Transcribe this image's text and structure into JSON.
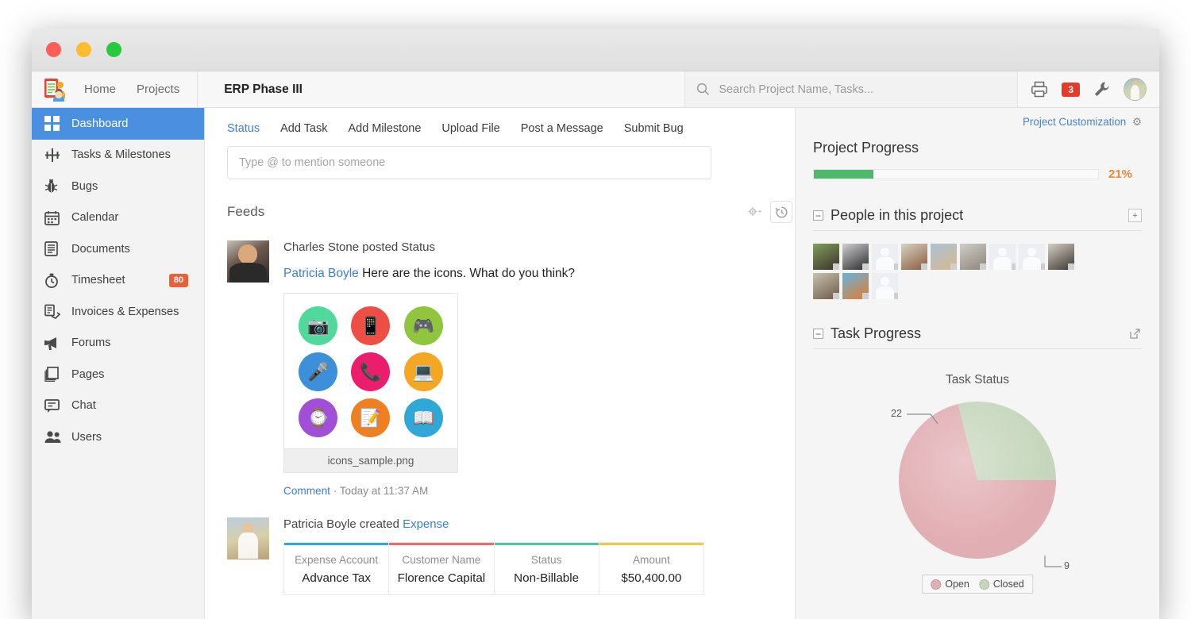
{
  "window": {
    "traffic_lights": [
      "close",
      "minimize",
      "maximize"
    ]
  },
  "topnav": {
    "logo_name": "project-logo",
    "links": [
      {
        "label": "Home",
        "name": "nav-home"
      },
      {
        "label": "Projects",
        "name": "nav-projects"
      }
    ],
    "project_title": "ERP Phase III",
    "search": {
      "placeholder": "Search Project Name, Tasks...",
      "value": ""
    },
    "actions": {
      "print_icon": "printer-icon",
      "notification_count": "3",
      "settings_icon": "wrench-icon",
      "avatar": "user-avatar"
    }
  },
  "sidebar": {
    "items": [
      {
        "label": "Dashboard",
        "icon": "grid-icon",
        "active": true,
        "badge": ""
      },
      {
        "label": "Tasks & Milestones",
        "icon": "milestone-icon",
        "active": false,
        "badge": ""
      },
      {
        "label": "Bugs",
        "icon": "bug-icon",
        "active": false,
        "badge": ""
      },
      {
        "label": "Calendar",
        "icon": "calendar-icon",
        "active": false,
        "badge": ""
      },
      {
        "label": "Documents",
        "icon": "document-icon",
        "active": false,
        "badge": ""
      },
      {
        "label": "Timesheet",
        "icon": "stopwatch-icon",
        "active": false,
        "badge": "80"
      },
      {
        "label": "Invoices & Expenses",
        "icon": "invoice-icon",
        "active": false,
        "badge": ""
      },
      {
        "label": "Forums",
        "icon": "megaphone-icon",
        "active": false,
        "badge": ""
      },
      {
        "label": "Pages",
        "icon": "pages-icon",
        "active": false,
        "badge": ""
      },
      {
        "label": "Chat",
        "icon": "chat-icon",
        "active": false,
        "badge": ""
      },
      {
        "label": "Users",
        "icon": "users-icon",
        "active": false,
        "badge": ""
      }
    ]
  },
  "center": {
    "action_tabs": [
      {
        "label": "Status",
        "active": true
      },
      {
        "label": "Add Task",
        "active": false
      },
      {
        "label": "Add Milestone",
        "active": false
      },
      {
        "label": "Upload File",
        "active": false
      },
      {
        "label": "Post a Message",
        "active": false
      },
      {
        "label": "Submit Bug",
        "active": false
      }
    ],
    "status_box_placeholder": "Type @ to mention someone",
    "feeds_title": "Feeds",
    "feeds_gear_icon": "gear-dropdown-icon",
    "feeds_history_icon": "history-clock-icon",
    "feed_items": [
      {
        "author": "Charles Stone",
        "headline": "Charles Stone posted Status",
        "mention": "Patricia Boyle",
        "message": "Here are the icons. What do you think?",
        "attachment": {
          "filename": "icons_sample.png",
          "icons": [
            {
              "name": "camera-hand-icon",
              "color": "#4fd99a",
              "glyph": "📷"
            },
            {
              "name": "smartphone-hand-icon",
              "color": "#ef4e44",
              "glyph": "📱"
            },
            {
              "name": "gamepad-hand-icon",
              "color": "#8fc63d",
              "glyph": "🎮"
            },
            {
              "name": "microphone-hand-icon",
              "color": "#3c8fd8",
              "glyph": "🎤"
            },
            {
              "name": "phone-call-hand-icon",
              "color": "#ec1d6c",
              "glyph": "📞"
            },
            {
              "name": "laptop-hand-icon",
              "color": "#f5a623",
              "glyph": "💻"
            },
            {
              "name": "smartwatch-hand-icon",
              "color": "#a14fd6",
              "glyph": "⌚"
            },
            {
              "name": "tablet-stylus-hand-icon",
              "color": "#ef8022",
              "glyph": "📝"
            },
            {
              "name": "ereader-hand-icon",
              "color": "#2fa8d8",
              "glyph": "📖"
            }
          ]
        },
        "comment_label": "Comment",
        "timestamp": "Today at 11:37 AM"
      },
      {
        "author": "Patricia Boyle",
        "headline_prefix": "Patricia Boyle created",
        "headline_link": "Expense",
        "table": {
          "columns": [
            {
              "label": "Expense Account",
              "value": "Advance Tax",
              "accent": "#29abe2"
            },
            {
              "label": "Customer Name",
              "value": "Florence Capital",
              "accent": "#f0686a"
            },
            {
              "label": "Status",
              "value": "Non-Billable",
              "accent": "#4dc7a4"
            },
            {
              "label": "Amount",
              "value": "$50,400.00",
              "accent": "#f5c93f"
            }
          ]
        }
      }
    ]
  },
  "right_panel": {
    "project_customization": "Project Customization",
    "project_customization_icon": "gear-icon",
    "progress": {
      "title": "Project Progress",
      "percent_label": "21%",
      "percent_value": 21,
      "bar_color": "#4cba6a",
      "label_color": "#e8873a"
    },
    "people": {
      "title": "People in this project",
      "collapse_icon": "collapse-minus-icon",
      "add_icon": "add-person-icon",
      "avatars": [
        {
          "name": "person-1",
          "type": "photo",
          "c1": "#7fa05c",
          "c2": "#3c2f28"
        },
        {
          "name": "person-2",
          "type": "photo",
          "c1": "#cfcfd6",
          "c2": "#2b2a28"
        },
        {
          "name": "person-3",
          "type": "placeholder"
        },
        {
          "name": "person-4",
          "type": "photo",
          "c1": "#d8d2c4",
          "c2": "#8a5a3a"
        },
        {
          "name": "person-5",
          "type": "photo",
          "c1": "#a9c2d8",
          "c2": "#d8b98a"
        },
        {
          "name": "person-6",
          "type": "photo",
          "c1": "#cfcfc7",
          "c2": "#8d8378"
        },
        {
          "name": "person-7",
          "type": "placeholder"
        },
        {
          "name": "person-8",
          "type": "placeholder"
        },
        {
          "name": "person-9",
          "type": "photo",
          "c1": "#d6cfc2",
          "c2": "#3a3530"
        },
        {
          "name": "person-10",
          "type": "photo",
          "c1": "#c9c2b0",
          "c2": "#6b5a45"
        },
        {
          "name": "person-11",
          "type": "photo",
          "c1": "#63b4e0",
          "c2": "#e87a2a"
        },
        {
          "name": "person-12",
          "type": "placeholder"
        }
      ]
    },
    "task_progress": {
      "title": "Task Progress",
      "collapse_icon": "collapse-minus-icon",
      "popout_icon": "popout-icon"
    }
  },
  "chart_data": {
    "type": "pie",
    "title": "Task Status",
    "categories": [
      "Open",
      "Closed"
    ],
    "values": [
      22,
      9
    ],
    "colors": [
      "#e1aeb3",
      "#c6d6bc"
    ],
    "labels": [
      "22",
      "9"
    ],
    "legend_position": "bottom",
    "total": 31
  }
}
